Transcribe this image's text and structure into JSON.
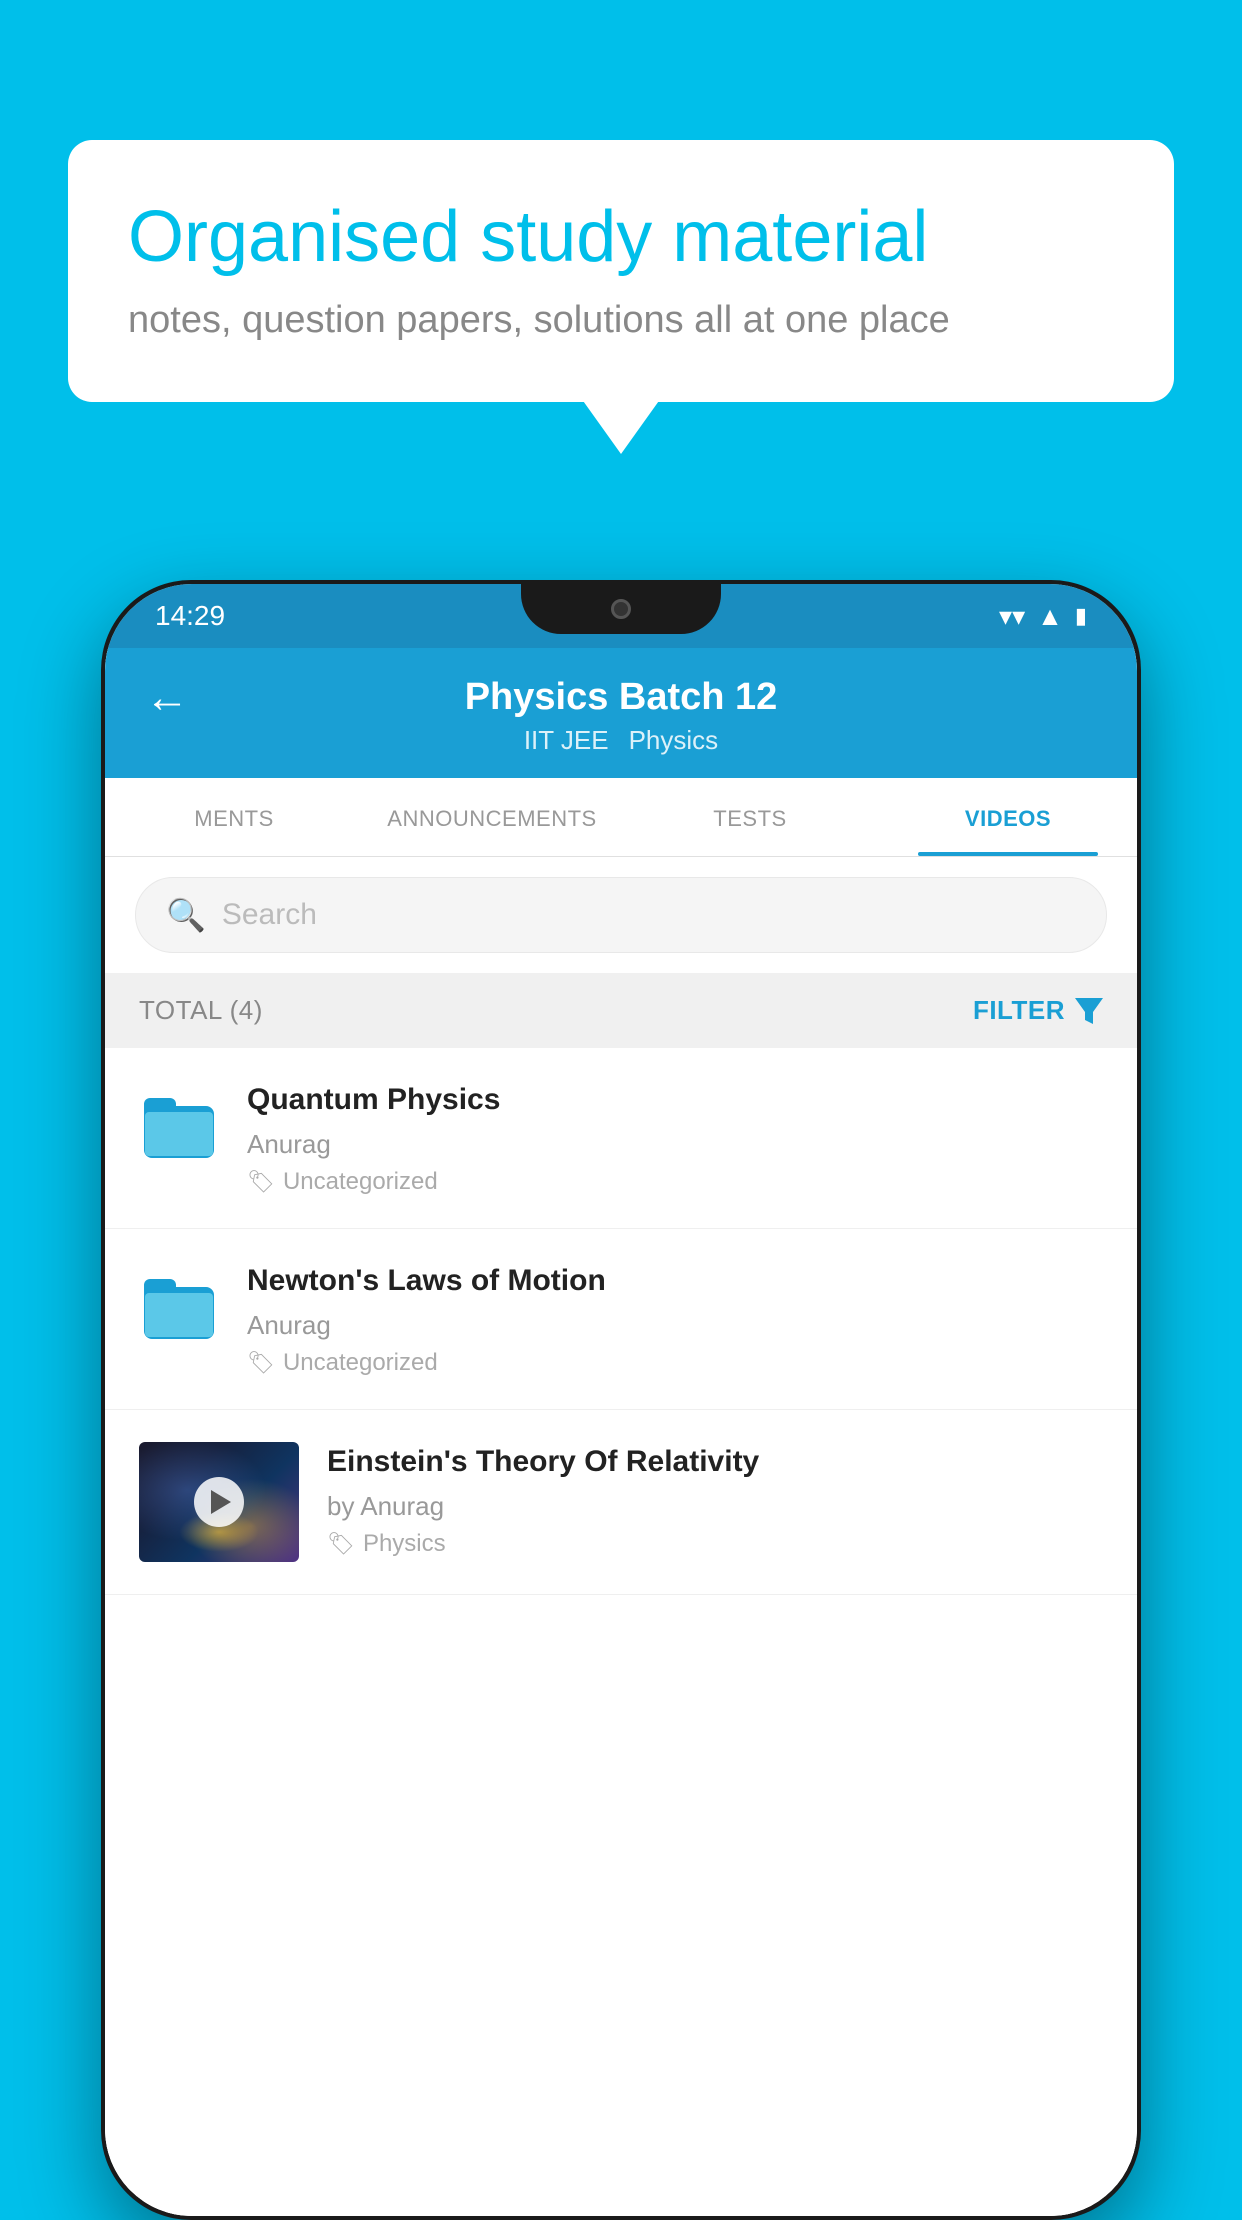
{
  "background_color": "#00BFEA",
  "speech_bubble": {
    "title": "Organised study material",
    "subtitle": "notes, question papers, solutions all at one place"
  },
  "phone": {
    "status_bar": {
      "time": "14:29",
      "icons": [
        "wifi",
        "signal",
        "battery"
      ]
    },
    "app_bar": {
      "title": "Physics Batch 12",
      "subtitle_parts": [
        "IIT JEE",
        "Physics"
      ],
      "back_label": "←"
    },
    "tabs": [
      {
        "label": "MENTS",
        "active": false
      },
      {
        "label": "ANNOUNCEMENTS",
        "active": false
      },
      {
        "label": "TESTS",
        "active": false
      },
      {
        "label": "VIDEOS",
        "active": true
      }
    ],
    "search": {
      "placeholder": "Search"
    },
    "filter_bar": {
      "total_label": "TOTAL (4)",
      "filter_label": "FILTER"
    },
    "video_items": [
      {
        "id": 1,
        "title": "Quantum Physics",
        "author": "Anurag",
        "tag": "Uncategorized",
        "has_thumbnail": false
      },
      {
        "id": 2,
        "title": "Newton's Laws of Motion",
        "author": "Anurag",
        "tag": "Uncategorized",
        "has_thumbnail": false
      },
      {
        "id": 3,
        "title": "Einstein's Theory Of Relativity",
        "author": "by Anurag",
        "tag": "Physics",
        "has_thumbnail": true
      }
    ]
  }
}
